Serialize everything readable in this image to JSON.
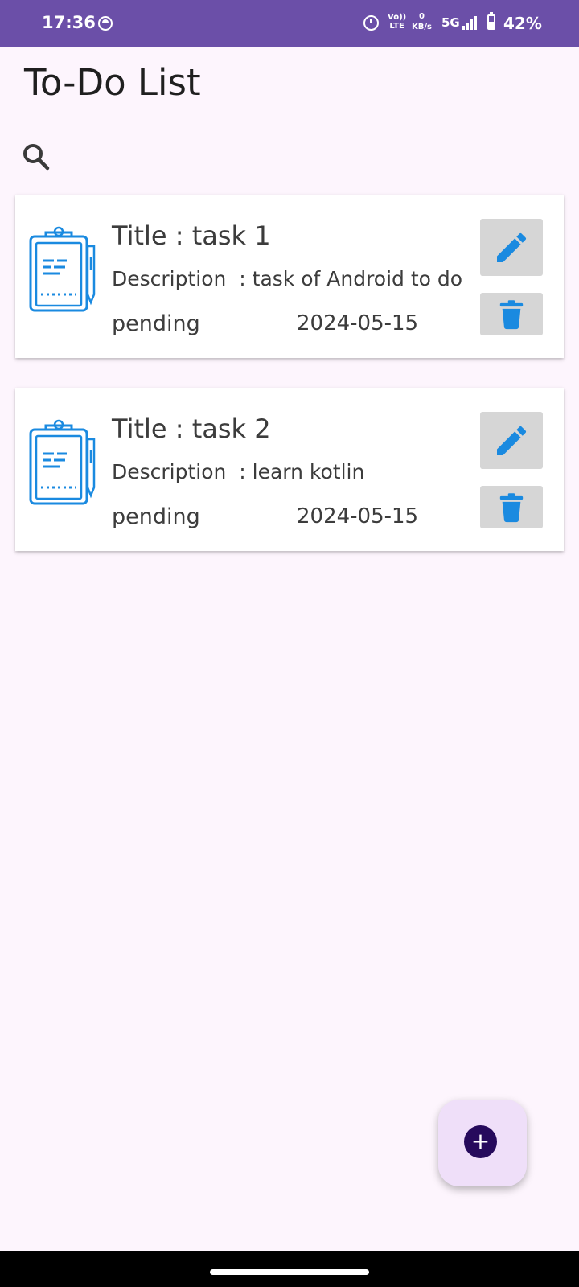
{
  "status_bar": {
    "time": "17:36",
    "volte_top": "Vo))",
    "volte_bottom": "LTE",
    "speed_value": "0",
    "speed_unit": "KB/s",
    "network": "5G",
    "battery_percent": "42%",
    "icons": [
      "notification-icon",
      "alarm-icon",
      "volte-icon",
      "signal-icon",
      "battery-charging-icon"
    ]
  },
  "header": {
    "title": "To-Do List",
    "search_icon": "search-icon"
  },
  "tasks": [
    {
      "title": "Title : task 1",
      "description": "Description  : task of Android to do",
      "status": "pending",
      "date": "2024-05-15"
    },
    {
      "title": "Title : task 2",
      "description": "Description  : learn kotlin",
      "status": "pending",
      "date": "2024-05-15"
    }
  ],
  "fab": {
    "label": "+",
    "icon": "add-icon"
  },
  "colors": {
    "status_bar": "#6b4fa8",
    "background": "#fdf5fd",
    "accent_icon": "#1a8ae0",
    "fab_container": "#efdff9",
    "fab_inner": "#260a5c"
  }
}
